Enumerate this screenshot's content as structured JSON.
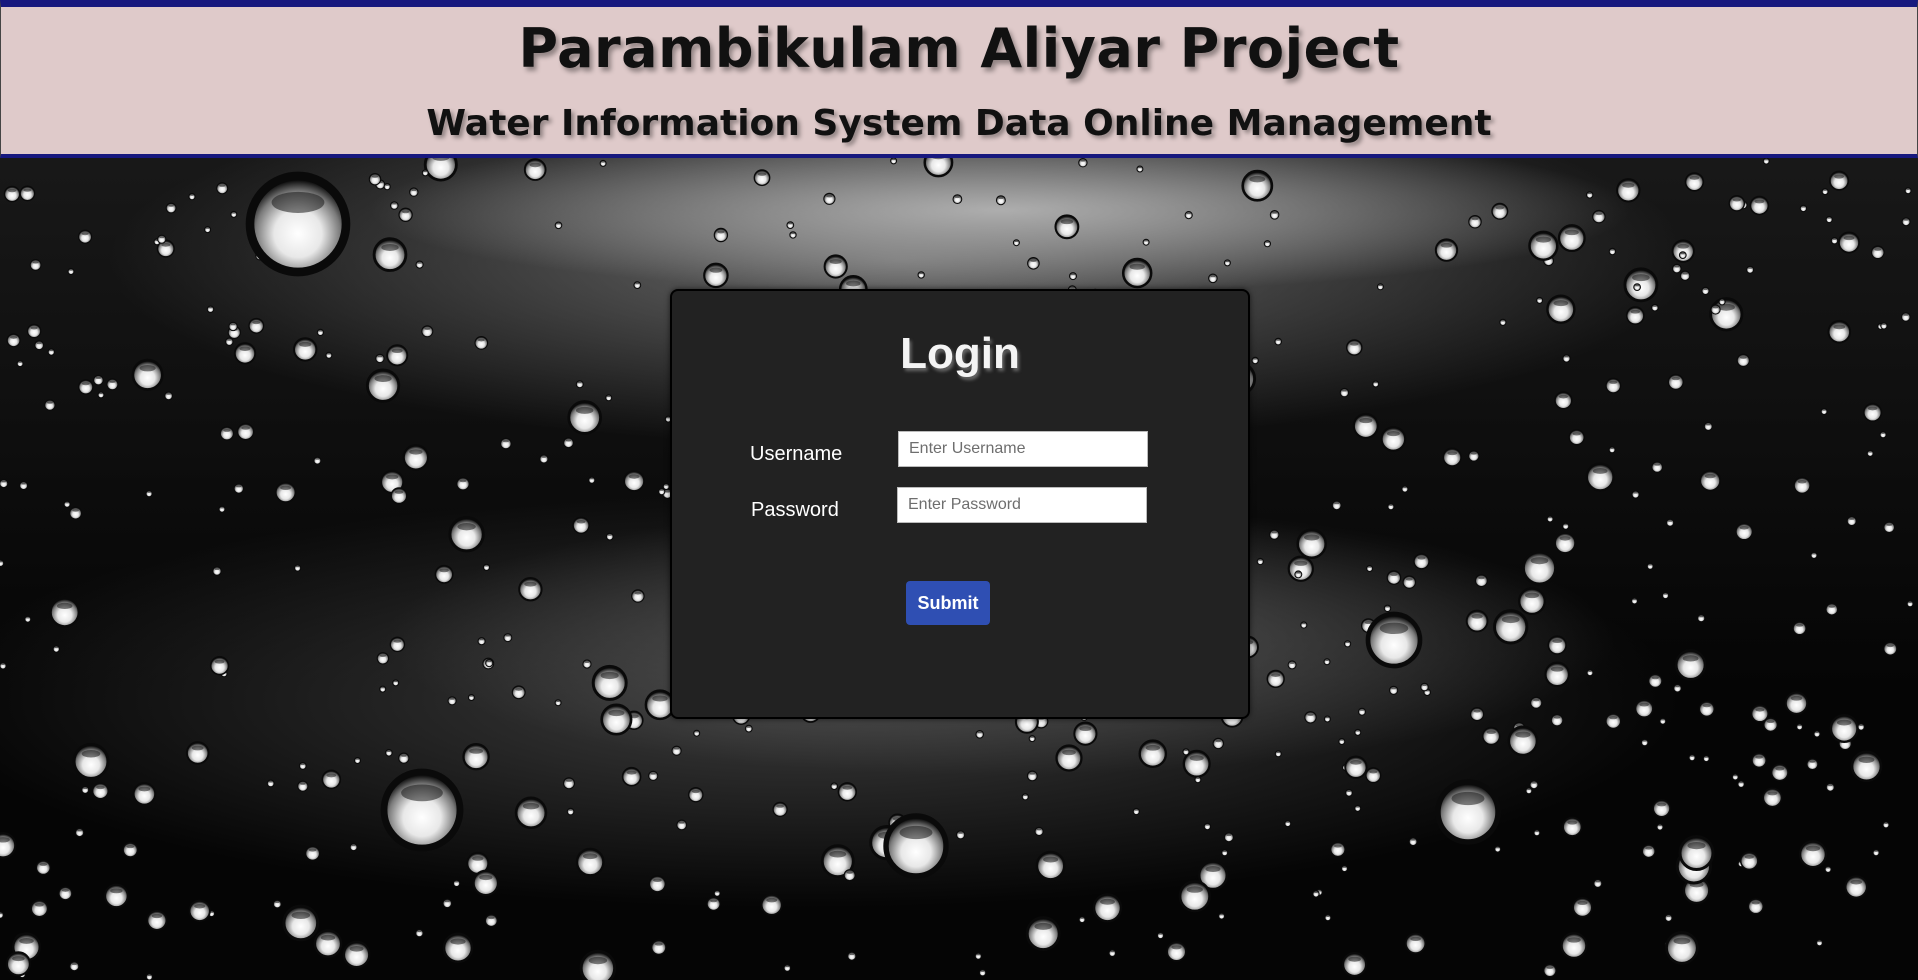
{
  "header": {
    "title": "Parambikulam Aliyar Project",
    "subtitle": "Water Information System Data Online Management"
  },
  "login": {
    "title": "Login",
    "username_label": "Username",
    "username_placeholder": "Enter Username",
    "username_value": "",
    "password_label": "Password",
    "password_placeholder": "Enter Password",
    "password_value": "",
    "submit_label": "Submit"
  },
  "colors": {
    "header_bg": "#dfcaca",
    "header_border": "#17187e",
    "card_bg": "#222222",
    "button_bg": "#2f4fb3"
  },
  "background": {
    "icon": "water-droplets-image"
  }
}
